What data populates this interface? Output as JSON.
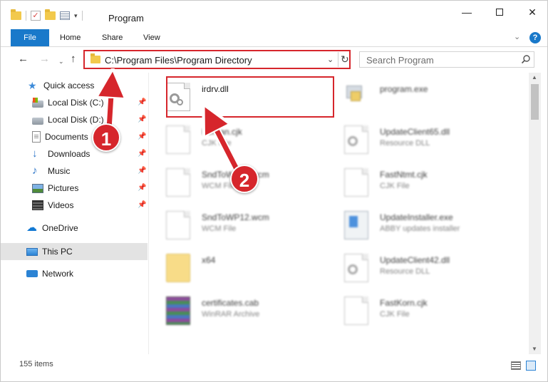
{
  "window": {
    "title": "Program"
  },
  "ribbon": {
    "tabs": [
      "File",
      "Home",
      "Share",
      "View"
    ]
  },
  "address": {
    "path": "C:\\Program Files\\Program Directory"
  },
  "search": {
    "placeholder": "Search Program"
  },
  "sidebar": {
    "quick_access": "Quick access",
    "items": [
      {
        "label": "Local Disk (C:)",
        "icon": "local-disk-icon",
        "pinned": true
      },
      {
        "label": "Local Disk (D:)",
        "icon": "local-disk-icon",
        "pinned": true
      },
      {
        "label": "Documents",
        "icon": "documents-icon",
        "pinned": true
      },
      {
        "label": "Downloads",
        "icon": "downloads-icon",
        "pinned": true
      },
      {
        "label": "Music",
        "icon": "music-icon",
        "pinned": true
      },
      {
        "label": "Pictures",
        "icon": "pictures-icon",
        "pinned": true
      },
      {
        "label": "Videos",
        "icon": "videos-icon",
        "pinned": true
      }
    ],
    "onedrive": "OneDrive",
    "this_pc": "This PC",
    "network": "Network"
  },
  "files": [
    {
      "name": "irdrv.dll",
      "type": "",
      "icon": "dll-icon",
      "highlighted": true,
      "blurred": false
    },
    {
      "name": "program.exe",
      "type": "",
      "icon": "exe-icon",
      "highlighted": false,
      "blurred": true
    },
    {
      "name": "Korean.cjk",
      "type": "CJK File",
      "icon": "file-icon",
      "highlighted": false,
      "blurred": true
    },
    {
      "name": "UpdateClient65.dll",
      "type": "Resource DLL",
      "icon": "dll-icon",
      "highlighted": false,
      "blurred": true
    },
    {
      "name": "SndToWP12.wcm",
      "type": "WCM File",
      "icon": "file-icon",
      "highlighted": false,
      "blurred": true
    },
    {
      "name": "FastNtmt.cjk",
      "type": "CJK File",
      "icon": "file-icon",
      "highlighted": false,
      "blurred": true
    },
    {
      "name": "SndToWP12.wcm",
      "type": "WCM File",
      "icon": "file-icon",
      "highlighted": false,
      "blurred": true
    },
    {
      "name": "UpdateInstaller.exe",
      "type": "ABBY updates installer",
      "icon": "installer-icon",
      "highlighted": false,
      "blurred": true
    },
    {
      "name": "x64",
      "type": "",
      "icon": "folder-icon",
      "highlighted": false,
      "blurred": true
    },
    {
      "name": "UpdateClient42.dll",
      "type": "Resource DLL",
      "icon": "dll-icon",
      "highlighted": false,
      "blurred": true
    },
    {
      "name": "certificates.cab",
      "type": "WinRAR Archive",
      "icon": "archive-icon",
      "highlighted": false,
      "blurred": true
    },
    {
      "name": "FastKorn.cjk",
      "type": "CJK File",
      "icon": "file-icon",
      "highlighted": false,
      "blurred": true
    }
  ],
  "status": {
    "item_count": "155 items"
  },
  "callouts": [
    "1",
    "2"
  ],
  "colors": {
    "accent": "#1979ca",
    "annotation_red": "#d6262c"
  }
}
